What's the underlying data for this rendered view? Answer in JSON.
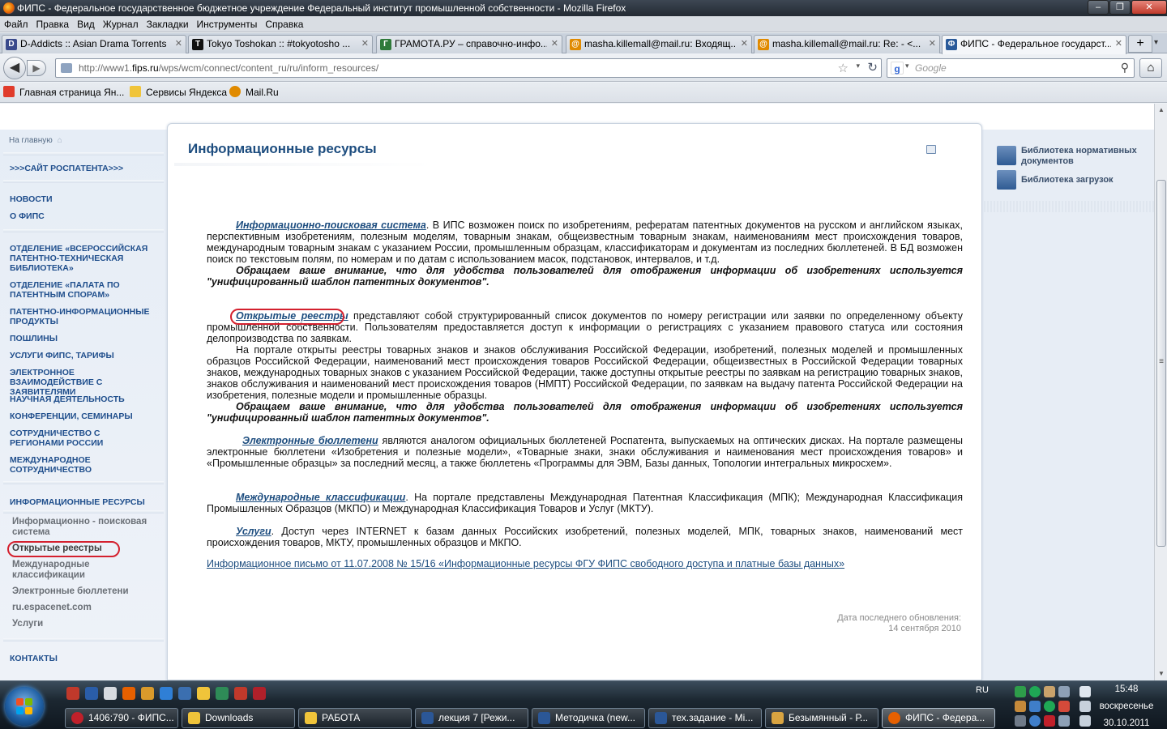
{
  "window": {
    "title": "ФИПС - Федеральное государственное бюджетное учреждение Федеральный институт промышленной собственности - Mozilla Firefox",
    "min": "–",
    "max": "❐",
    "close": "✕"
  },
  "menubar": [
    "Файл",
    "Правка",
    "Вид",
    "Журнал",
    "Закладки",
    "Инструменты",
    "Справка"
  ],
  "tabs": [
    {
      "label": "D-Addicts :: Asian Drama Torrents",
      "icon": "d-addicts-icon",
      "color": "#3a4a8c",
      "glyph": "D",
      "close": "✕"
    },
    {
      "label": "Tokyo Toshokan :: #tokyotosho ...",
      "icon": "tokyotosho-icon",
      "color": "#111111",
      "glyph": "T",
      "close": "✕"
    },
    {
      "label": "ГРАМОТА.РУ – справочно-инфо...",
      "icon": "gramota-icon",
      "color": "#2f7a3a",
      "glyph": "Г",
      "close": "✕"
    },
    {
      "label": "masha.killemall@mail.ru: Входящ...",
      "icon": "mailru-icon",
      "color": "#e08a00",
      "glyph": "@",
      "close": "✕"
    },
    {
      "label": "masha.killemall@mail.ru: Re: - <...",
      "icon": "mailru-icon",
      "color": "#e08a00",
      "glyph": "@",
      "close": "✕"
    },
    {
      "label": "ФИПС - Федеральное государст...",
      "icon": "fips-icon",
      "color": "#2a5a9a",
      "glyph": "Ф",
      "close": "✕",
      "active": true
    }
  ],
  "newtab": "+",
  "tab_scroll": "▾",
  "nav": {
    "back": "◀",
    "forward": "▶",
    "url_prefix": "http://www1.",
    "url_host": "fips.ru",
    "url_rest": "/wps/wcm/connect/content_ru/ru/inform_resources/",
    "star": "☆",
    "dropdown": "▾",
    "reload": "↻",
    "search_placeholder": "Google",
    "search_engine": "g",
    "search_go": "⚲",
    "home": "⌂"
  },
  "bookmarks": [
    {
      "label": "Главная страница Ян...",
      "icon": "yandex-icon",
      "color": "#e03b2b"
    },
    {
      "label": "Сервисы Яндекса",
      "icon": "folder-icon",
      "color": "#f0c43a"
    },
    {
      "label": "Mail.Ru",
      "icon": "mailru-icon",
      "color": "#e08a00"
    }
  ],
  "sidebar": {
    "home": "На главную",
    "home_icon": "⌂",
    "rospatent": ">>>САЙТ РОСПАТЕНТА>>>",
    "links": [
      "НОВОСТИ",
      "О ФИПС",
      "ОТДЕЛЕНИЕ «ВСЕРОССИЙСКАЯ ПАТЕНТНО-ТЕХНИЧЕСКАЯ БИБЛИОТЕКА»",
      "ОТДЕЛЕНИЕ «ПАЛАТА ПО ПАТЕНТНЫМ СПОРАМ»",
      "ПАТЕНТНО-ИНФОРМАЦИОННЫЕ ПРОДУКТЫ",
      "ПОШЛИНЫ",
      "УСЛУГИ ФИПС, ТАРИФЫ",
      "ЭЛЕКТРОННОЕ ВЗАИМОДЕЙСТВИЕ С ЗАЯВИТЕЛЯМИ",
      "НАУЧНАЯ ДЕЯТЕЛЬНОСТЬ",
      "КОНФЕРЕНЦИИ, СЕМИНАРЫ",
      "СОТРУДНИЧЕСТВО С РЕГИОНАМИ РОССИИ",
      "МЕЖДУНАРОДНОЕ СОТРУДНИЧЕСТВО",
      "ИНФОРМАЦИОННЫЕ РЕСУРСЫ"
    ],
    "sublinks": [
      "Информационно - поисковая система",
      "Открытые реестры",
      "Международные классификации",
      "Электронные бюллетени",
      "ru.espacenet.com",
      "Услуги"
    ],
    "contacts": "КОНТАКТЫ"
  },
  "content": {
    "title": "Информационные ресурсы",
    "p1_link": "Информационно-поисковая система",
    "p1_text": ". В ИПС возможен поиск по изобретениям, рефератам патентных документов на русском и английском языках, перспективным изобретениям, полезным моделям, товарным знакам, общеизвестным товарным знакам, наименованиям мест происхождения товаров, международным товарным знакам с указанием России, промышленным образцам, классификаторам и документам из последних бюллетеней. В БД возможен поиск по текстовым полям, по номерам и по датам с использованием масок, подстановок, интервалов, и т.д.",
    "note1": "Обращаем ваше внимание, что для удобства пользователей для отображения информации об изобретениях используется \"унифицированный шаблон патентных документов\".",
    "p2_link": "Открытые реестры",
    "p2_text": " представляют собой структурированный список документов по номеру регистрации или заявки по определенному объекту промышленной собственности. Пользователям предоставляется доступ к информации о регистрациях с указанием правового статуса или состояния делопроизводства по заявкам.",
    "p3_text": "На портале открыты реестры товарных знаков и знаков обслуживания Российской Федерации, изобретений, полезных моделей и промышленных образцов Российской Федерации, наименований мест происхождения товаров Российской Федерации, общеизвестных в Российской Федерации товарных знаков, международных товарных знаков с указанием Российской Федерации, также доступны открытые реестры по заявкам на регистрацию товарных знаков, знаков обслуживания и наименований мест происхождения товаров (НМПТ) Российской Федерации, по заявкам на выдачу патента Российской Федерации на изобретения, полезные модели и промышленные образцы.",
    "note2": "Обращаем ваше внимание, что для удобства пользователей для отображения информации об изобретениях используется \"унифицированный шаблон патентных документов\".",
    "p4_link": "Электронные бюллетени",
    "p4_text": " являются аналогом официальных бюллетеней Роспатента, выпускаемых на оптических дисках. На портале размещены электронные бюллетени «Изобретения и полезные модели», «Товарные знаки, знаки обслуживания и наименования мест происхождения товаров» и «Промышленные образцы» за последний месяц, а также бюллетень «Программы для ЭВМ, Базы данных, Топологии интегральных микросхем».",
    "p5_link": "Международные классификации",
    "p5_text": ". На портале представлены Международная Патентная Классификация (МПК); Международная Классификация Промышленных Образцов (МКПО) и Международная Классификация Товаров и Услуг (МКТУ).",
    "p6_link": "Услуги",
    "p6_text": ". Доступ через INTERNET к базам данных Российских изобретений, полезных моделей, МПК, товарных знаков, наименований мест происхождения товаров, МКТУ, промышленных образцов и МКПО.",
    "info_letter": "Информационное письмо от 11.07.2008 № 15/16   «Информационные ресурсы ФГУ ФИПС свободного доступа и платные базы данных»",
    "update_label": "Дата последнего обновления:",
    "update_date": "14 сентября 2010"
  },
  "right_sidebar": [
    {
      "label": "Библиотека нормативных документов",
      "icon": "book-icon"
    },
    {
      "label": "Библиотека загрузок",
      "icon": "floppy-icon"
    }
  ],
  "scroll": {
    "up": "▲",
    "down": "▼",
    "grip": "≡"
  },
  "taskbar": {
    "quicklaunch": [
      "#c0392b",
      "#2a5da8",
      "#d7dbe0",
      "#e66000",
      "#d99a2b",
      "#2f7fd6",
      "#3b6fb0",
      "#f0c43a",
      "#2e8b57",
      "#c0392b",
      "#b0202a"
    ],
    "tasks": [
      {
        "label": "1406:790 - ФИПС...",
        "icon": "opera-icon",
        "color": "#c0202a"
      },
      {
        "label": "Downloads",
        "icon": "folder-icon",
        "color": "#f0c43a"
      },
      {
        "label": "РАБОТА",
        "icon": "folder-icon",
        "color": "#f0c43a"
      },
      {
        "label": "лекция 7 [Режи...",
        "icon": "word-icon",
        "color": "#2b5797"
      },
      {
        "label": "Методичка (new...",
        "icon": "word-icon",
        "color": "#2b5797"
      },
      {
        "label": "тех.задание - Mi...",
        "icon": "word-icon",
        "color": "#2b5797"
      },
      {
        "label": "Безымянный - Р...",
        "icon": "paint-icon",
        "color": "#d9a441"
      },
      {
        "label": "ФИПС - Федера...",
        "icon": "firefox-icon",
        "color": "#e66000",
        "active": true
      }
    ],
    "lang": "RU",
    "time": "15:48",
    "weekday": "воскресенье",
    "date": "30.10.2011"
  }
}
